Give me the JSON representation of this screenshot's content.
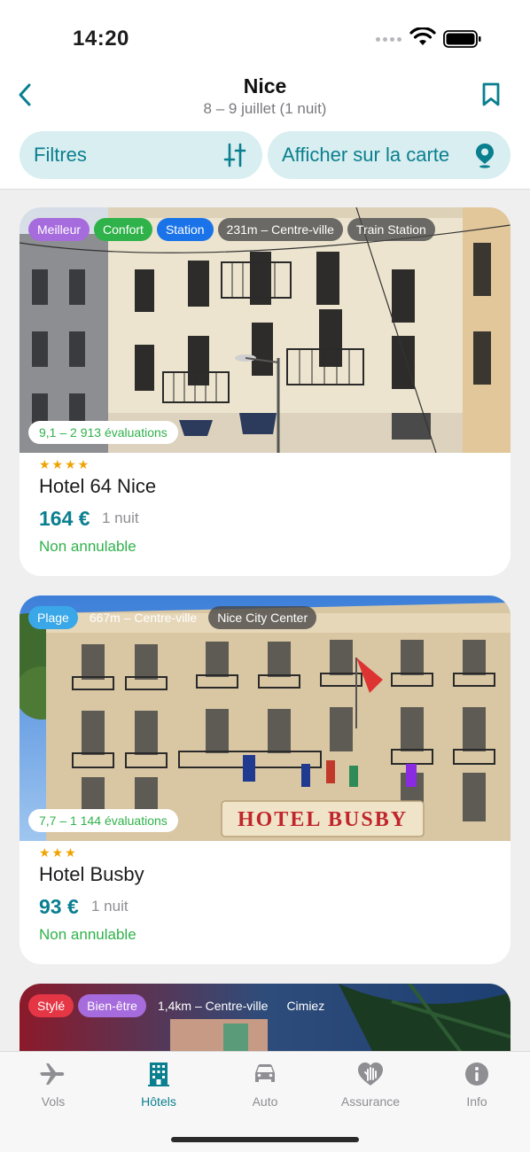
{
  "status": {
    "time": "14:20"
  },
  "header": {
    "title": "Nice",
    "subtitle": "8 – 9 juillet (1 nuit)",
    "filters_label": "Filtres",
    "map_label": "Afficher sur la carte"
  },
  "colors": {
    "accent": "#0a7f8f",
    "pill_bg": "#d8eef0",
    "success": "#2fb24a",
    "stars": "#f0a300"
  },
  "hotels": [
    {
      "tags": [
        "Meilleur",
        "Confort",
        "Station",
        "231m – Centre-ville",
        "Train Station"
      ],
      "rating": "9,1 – 2 913 évaluations",
      "stars": "★★★★",
      "name": "Hotel 64 Nice",
      "price": "164 €",
      "nights": "1 nuit",
      "cancellation": "Non annulable"
    },
    {
      "tags": [
        "Plage",
        "667m – Centre-ville",
        "Nice City Center"
      ],
      "rating": "7,7 – 1 144 évaluations",
      "stars": "★★★",
      "name": "Hotel Busby",
      "price": "93 €",
      "nights": "1 nuit",
      "cancellation": "Non annulable",
      "sign": "HOTEL BUSBY"
    },
    {
      "tags": [
        "Stylé",
        "Bien-être",
        "1,4km – Centre-ville",
        "Cimiez"
      ]
    }
  ],
  "tabs": [
    {
      "label": "Vols",
      "icon": "plane-icon"
    },
    {
      "label": "Hôtels",
      "icon": "building-icon",
      "active": true
    },
    {
      "label": "Auto",
      "icon": "car-icon"
    },
    {
      "label": "Assurance",
      "icon": "heart-hand-icon"
    },
    {
      "label": "Info",
      "icon": "info-icon"
    }
  ]
}
